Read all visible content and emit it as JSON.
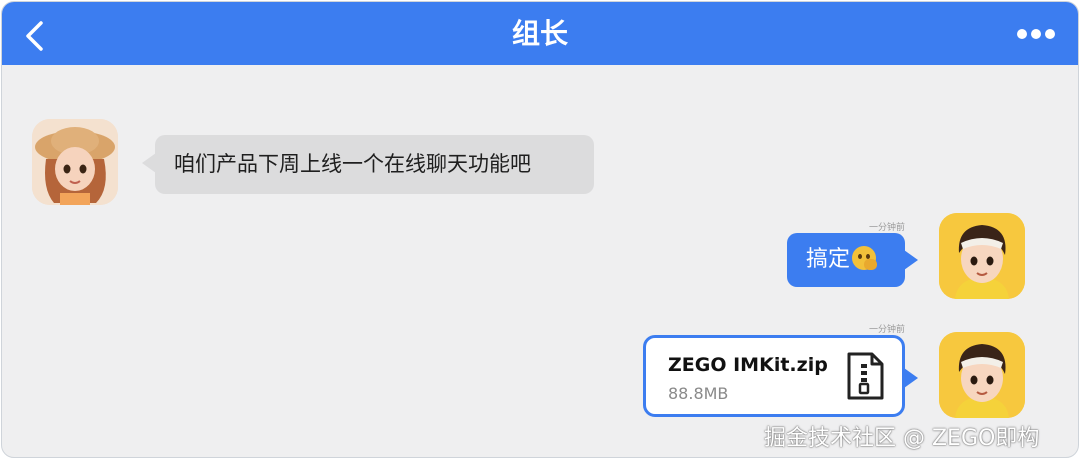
{
  "header": {
    "title": "组长",
    "back_icon": "chevron-left-icon",
    "more_icon": "more-dots-icon",
    "color": "#3c7df0"
  },
  "messages": [
    {
      "side": "left",
      "sender_avatar": "girl-avatar",
      "text": "咱们产品下周上线一个在线聊天功能吧"
    },
    {
      "side": "right",
      "sender_avatar": "boy-avatar",
      "time": "一分钟前",
      "text": "搞定",
      "emoji": "thinking-face-emoji"
    },
    {
      "side": "right",
      "sender_avatar": "boy-avatar",
      "time": "一分钟前",
      "file": {
        "name": "ZEGO IMKit.zip",
        "size": "88.8MB",
        "icon": "zip-file-icon"
      }
    }
  ],
  "watermark": "掘金技术社区 @ ZEGO即构"
}
